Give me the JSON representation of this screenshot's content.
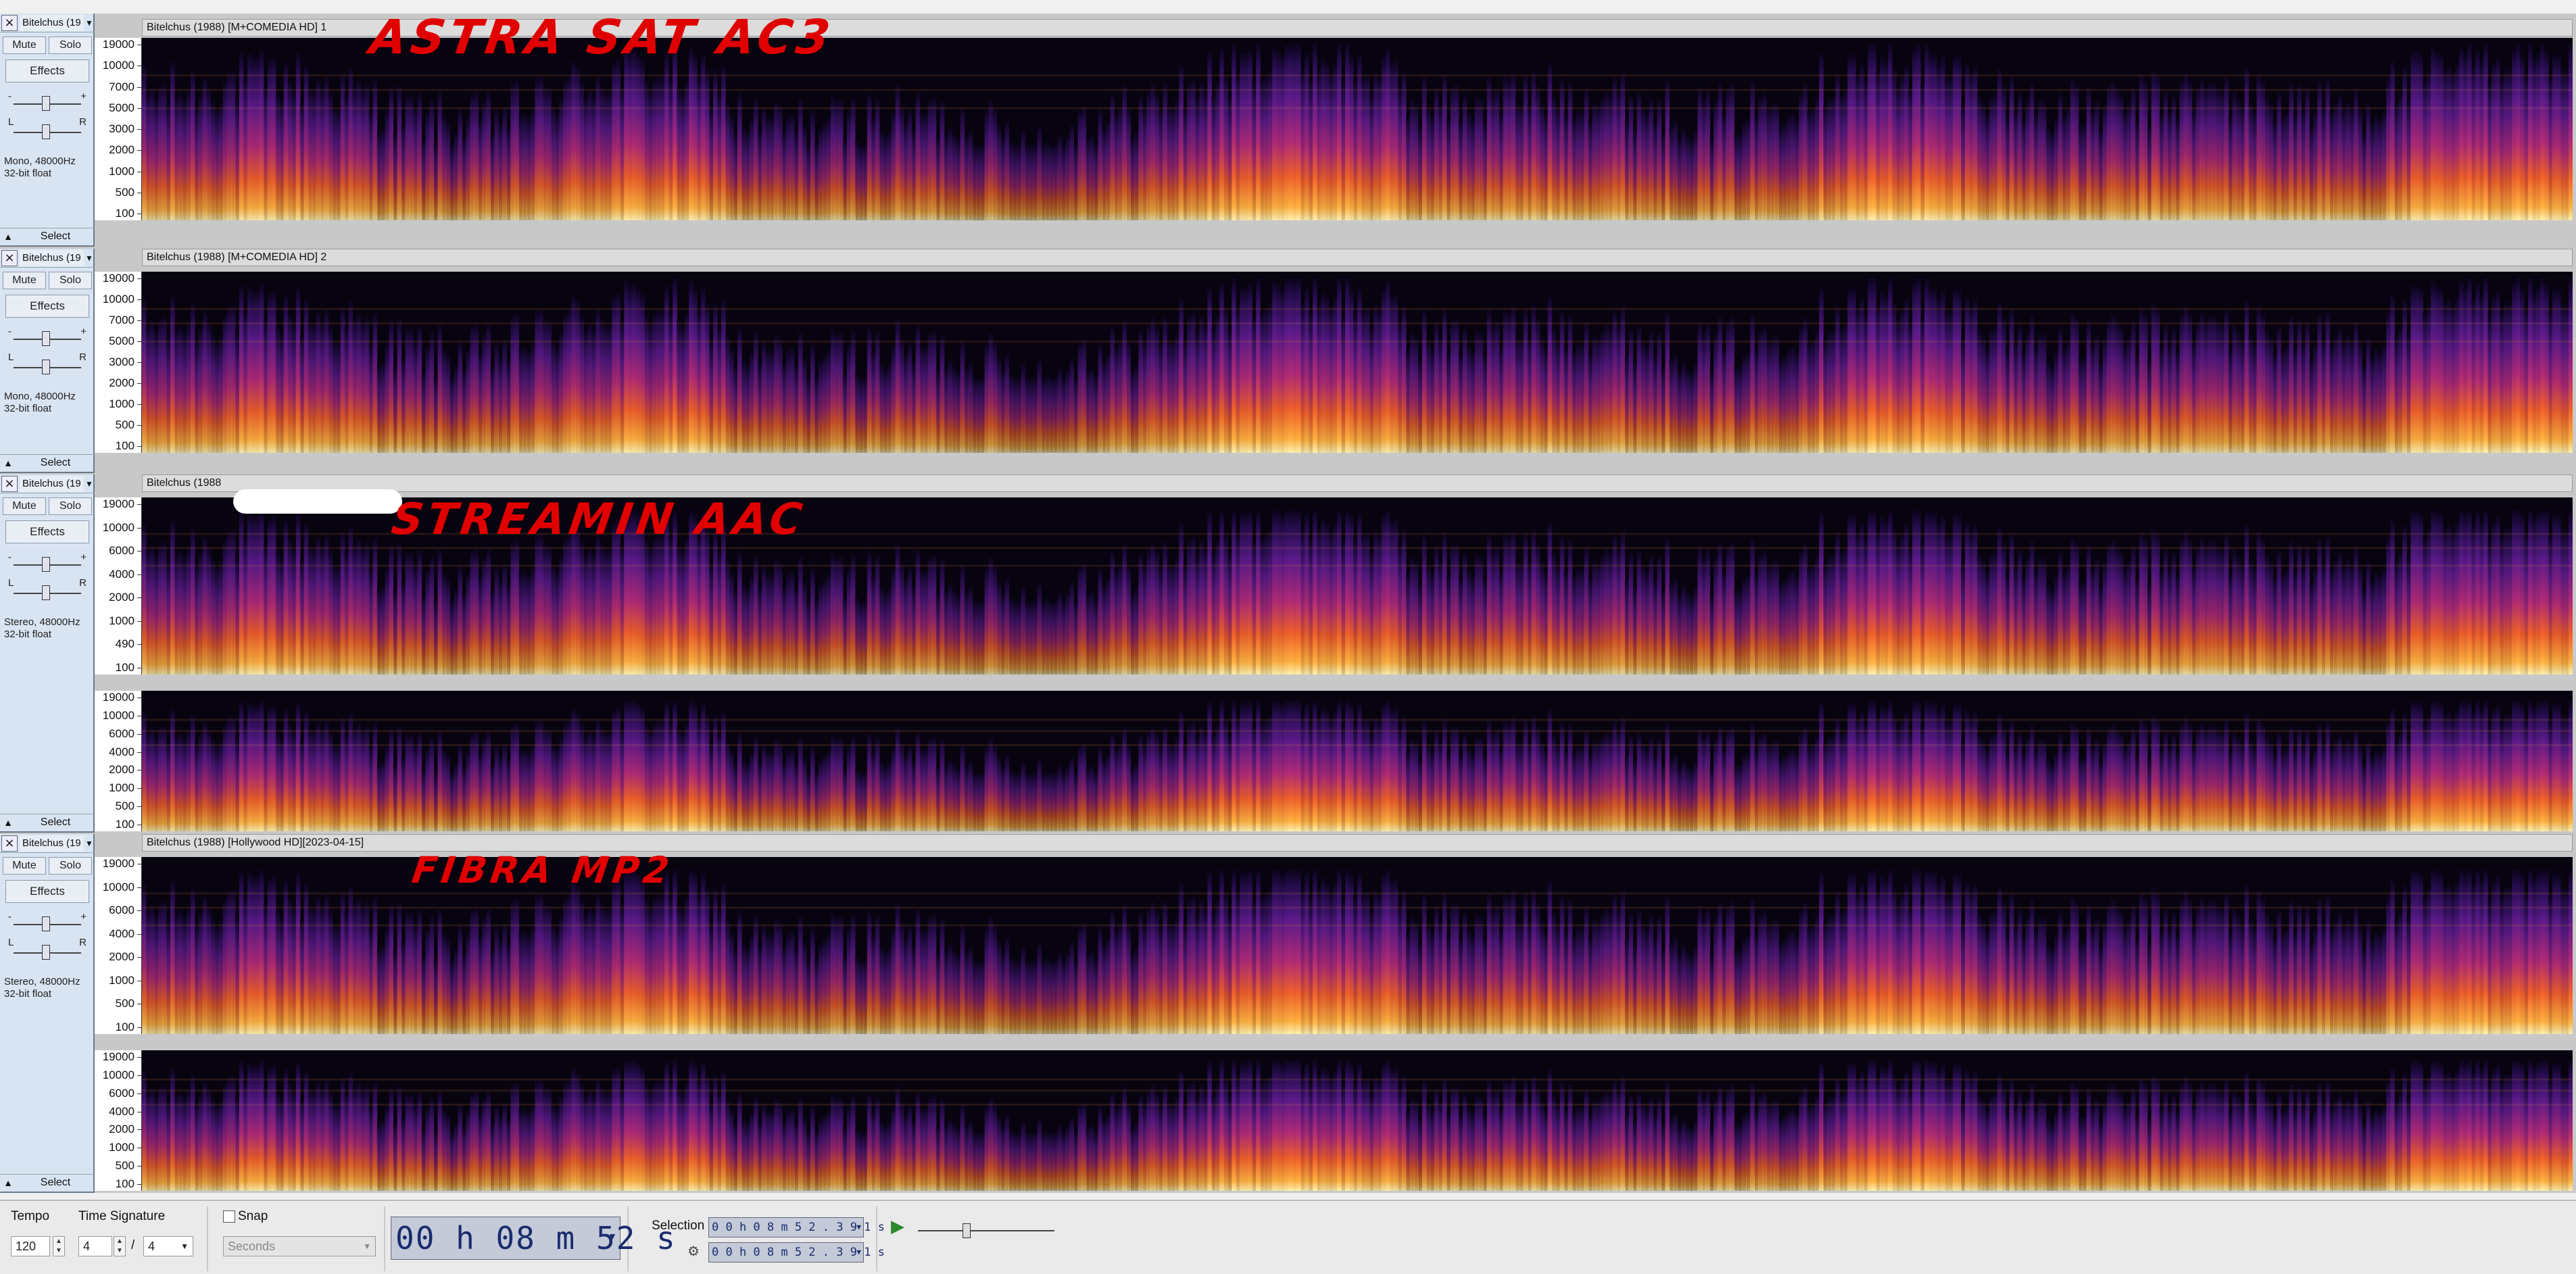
{
  "colors": {
    "spec_low": "#1a0a3c",
    "spec_mid": "#8a1c8c",
    "spec_high": "#ff7a2a",
    "annotation": "#e00000",
    "time_text": "#1a2c6e"
  },
  "tracks": [
    {
      "name": "Bitelchus (19",
      "clip": "Bitelchus (1988) [M+COMEDIA HD] 1",
      "mute": "Mute",
      "solo": "Solo",
      "effects": "Effects",
      "gain_minus": "-",
      "gain_plus": "+",
      "pan_l": "L",
      "pan_r": "R",
      "info1": "Mono, 48000Hz",
      "info2": "32-bit float",
      "select": "Select",
      "annotation": "ASTRA SAT AC3",
      "channels": [
        {
          "ticks": [
            "19000",
            "10000",
            "7000",
            "5000",
            "3000",
            "2000",
            "1000",
            "500",
            "100"
          ]
        }
      ]
    },
    {
      "name": "Bitelchus (19",
      "clip": "Bitelchus (1988) [M+COMEDIA HD] 2",
      "mute": "Mute",
      "solo": "Solo",
      "effects": "Effects",
      "gain_minus": "-",
      "gain_plus": "+",
      "pan_l": "L",
      "pan_r": "R",
      "info1": "Mono, 48000Hz",
      "info2": "32-bit float",
      "select": "Select",
      "annotation": "",
      "channels": [
        {
          "ticks": [
            "19000",
            "10000",
            "7000",
            "5000",
            "3000",
            "2000",
            "1000",
            "500",
            "100"
          ]
        }
      ]
    },
    {
      "name": "Bitelchus (19",
      "clip": "Bitelchus (1988",
      "mute": "Mute",
      "solo": "Solo",
      "effects": "Effects",
      "gain_minus": "-",
      "gain_plus": "+",
      "pan_l": "L",
      "pan_r": "R",
      "info1": "Stereo, 48000Hz",
      "info2": "32-bit float",
      "select": "Select",
      "annotation": "STREAMIN AAC",
      "channels": [
        {
          "ticks": [
            "19000",
            "10000",
            "6000",
            "4000",
            "2000",
            "1000",
            "490",
            "100"
          ]
        },
        {
          "ticks": [
            "19000",
            "10000",
            "6000",
            "4000",
            "2000",
            "1000",
            "500",
            "100"
          ]
        }
      ]
    },
    {
      "name": "Bitelchus (19",
      "clip": "Bitelchus (1988) [Hollywood HD][2023-04-15]",
      "mute": "Mute",
      "solo": "Solo",
      "effects": "Effects",
      "gain_minus": "-",
      "gain_plus": "+",
      "pan_l": "L",
      "pan_r": "R",
      "info1": "Stereo, 48000Hz",
      "info2": "32-bit float",
      "select": "Select",
      "annotation": "FIBRA MP2",
      "channels": [
        {
          "ticks": [
            "19000",
            "10000",
            "6000",
            "4000",
            "2000",
            "1000",
            "500",
            "100"
          ]
        },
        {
          "ticks": [
            "19000",
            "10000",
            "6000",
            "4000",
            "2000",
            "1000",
            "500",
            "100"
          ]
        }
      ]
    }
  ],
  "toolbar": {
    "tempo_label": "Tempo",
    "tempo_value": "120",
    "timesig_label": "Time Signature",
    "timesig_num": "4",
    "timesig_sep": "/",
    "timesig_den": "4",
    "snap_label": "Snap",
    "snap_unit": "Seconds",
    "time_display": "00 h 08 m 52 s",
    "selection_label": "Selection",
    "selection_start": "0 0 h 0 8 m 5 2 . 3 9 1 s",
    "selection_end": "0 0 h 0 8 m 5 2 . 3 9 1 s"
  }
}
